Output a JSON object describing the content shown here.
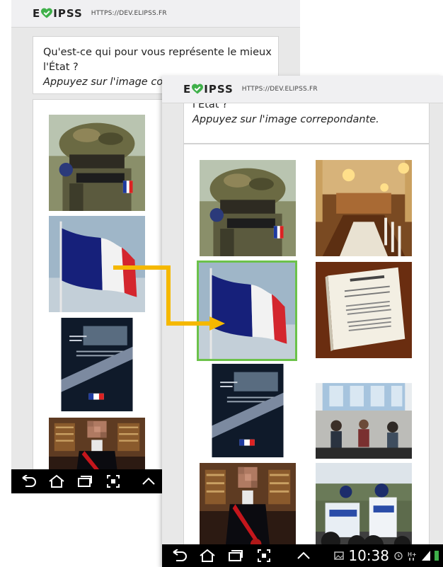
{
  "header": {
    "logo": {
      "letter_e": "E",
      "letters_ipss": "IPSS"
    },
    "url": "HTTPS://DEV.ELIPSS.FR"
  },
  "question": {
    "line1": "Qu'est-ce qui pour vous représente le mieux",
    "line2": "l'État ?",
    "instruction_full": "Appuyez sur l'image correpondante.",
    "instruction_truncated": "Appuyez sur l'image corr"
  },
  "images": {
    "left_column": [
      "soldier-photo",
      "french-flag-photo",
      "document-cover-photo",
      "official-portrait-photo"
    ],
    "right_column": [
      "palace-hall-photo",
      "constitution-photo",
      "waiting-room-photo",
      "police-motorcycles-photo"
    ],
    "selected": "french-flag-photo"
  },
  "status_bar": {
    "time": "10:38"
  },
  "colors": {
    "brand_green": "#3fb04a",
    "selection_border": "#6cc24a",
    "arrow": "#f5b800",
    "navbar": "#000000"
  },
  "icons": {
    "navbar": [
      "back-icon",
      "home-icon",
      "recent-apps-icon",
      "screenshot-icon",
      "chevron-up-icon"
    ],
    "status": [
      "gallery-notification-icon",
      "alarm-icon",
      "hplus-data-icon",
      "signal-icon",
      "battery-icon"
    ]
  }
}
